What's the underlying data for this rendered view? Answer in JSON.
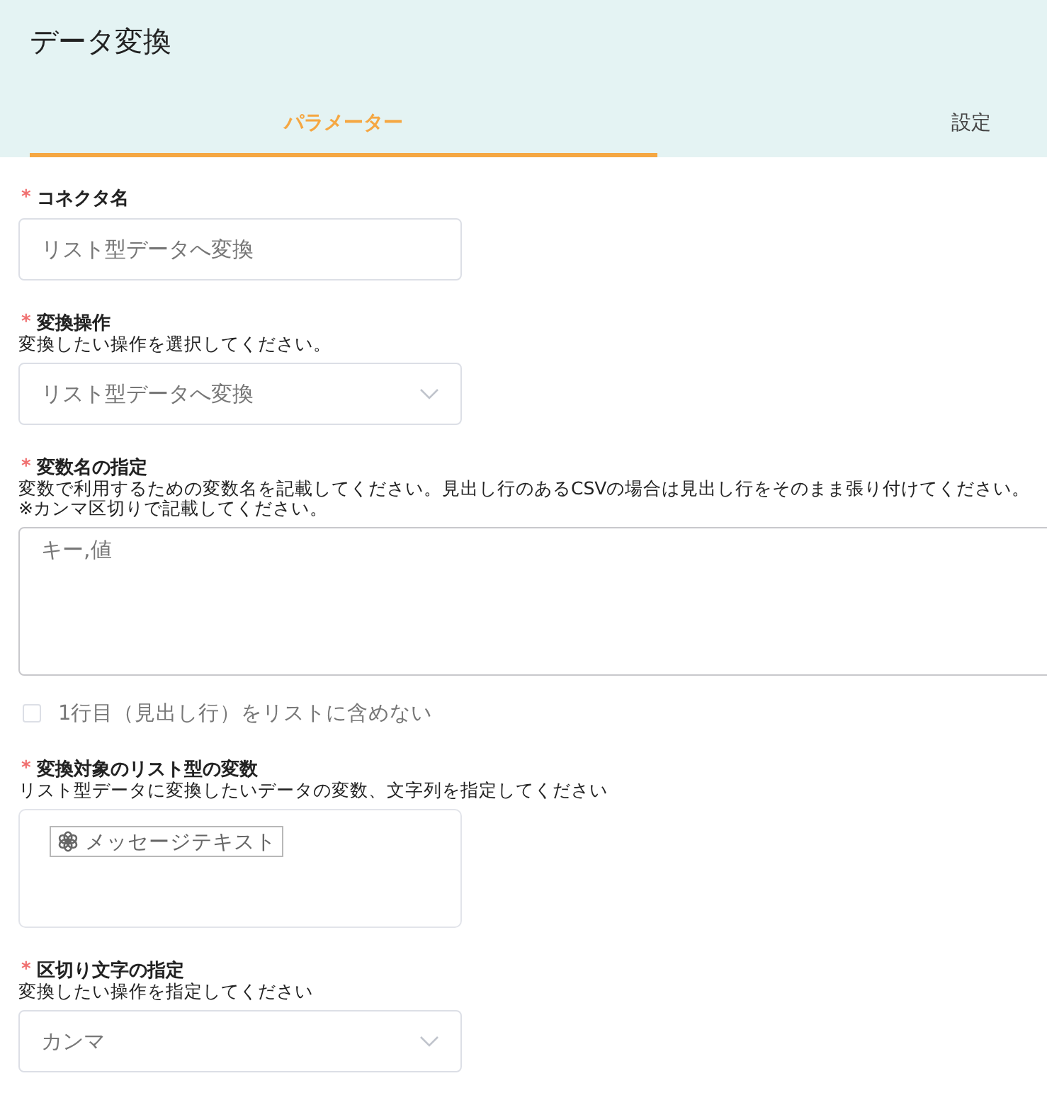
{
  "header": {
    "title": "データ変換"
  },
  "tabs": [
    {
      "label": "パラメーター",
      "selected": true
    },
    {
      "label": "設定",
      "selected": false
    }
  ],
  "fields": [
    {
      "kind": "text",
      "label": "コネクタ名",
      "required_mark": "*",
      "value": "リスト型データへ変換"
    },
    {
      "kind": "select",
      "label": "変換操作",
      "required_mark": "*",
      "descriptions": [
        "変換したい操作を選択してください。"
      ],
      "value": "リスト型データへ変換"
    },
    {
      "kind": "textarea",
      "label": "変数名の指定",
      "required_mark": "*",
      "descriptions": [
        "変数で利用するための変数名を記載してください。見出し行のあるCSVの場合は見出し行をそのまま張り付けてください。",
        "※カンマ区切りで記載してください。"
      ],
      "value": "キー,値"
    },
    {
      "kind": "checkbox",
      "label": "1行目（見出し行）をリストに含めない",
      "checked": false
    },
    {
      "kind": "tags",
      "label": "変換対象のリスト型の変数",
      "required_mark": "*",
      "descriptions": [
        "リスト型データに変換したいデータの変数、文字列を指定してください"
      ],
      "tags": [
        "メッセージテキスト"
      ]
    },
    {
      "kind": "select",
      "label": "区切り文字の指定",
      "required_mark": "*",
      "descriptions": [
        "変換したい操作を指定してください"
      ],
      "value": "カンマ"
    }
  ]
}
